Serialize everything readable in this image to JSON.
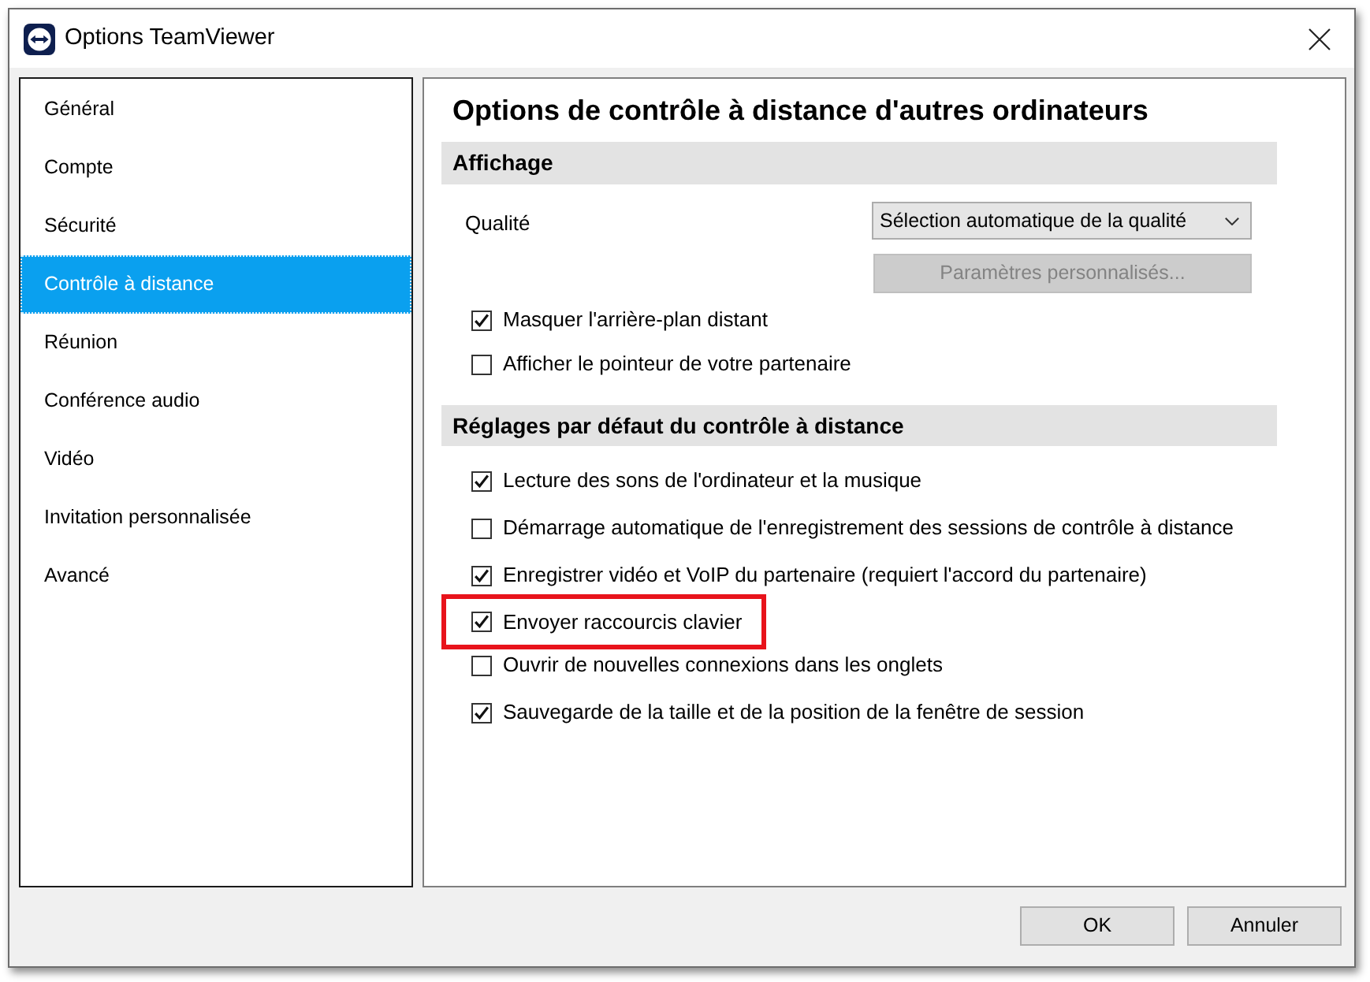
{
  "window": {
    "title": "Options TeamViewer"
  },
  "sidebar": {
    "items": [
      {
        "label": "Général",
        "selected": false
      },
      {
        "label": "Compte",
        "selected": false
      },
      {
        "label": "Sécurité",
        "selected": false
      },
      {
        "label": "Contrôle à distance",
        "selected": true
      },
      {
        "label": "Réunion",
        "selected": false
      },
      {
        "label": "Conférence audio",
        "selected": false
      },
      {
        "label": "Vidéo",
        "selected": false
      },
      {
        "label": "Invitation personnalisée",
        "selected": false
      },
      {
        "label": "Avancé",
        "selected": false
      }
    ]
  },
  "content": {
    "title": "Options de contrôle à distance d'autres ordinateurs",
    "sections": [
      {
        "title": "Affichage",
        "rows": [
          {
            "kind": "dropdown",
            "label": "Qualité",
            "value": "Sélection automatique de la qualité"
          },
          {
            "kind": "button",
            "label": "Paramètres personnalisés...",
            "disabled": true
          },
          {
            "kind": "checkbox",
            "label": "Masquer l'arrière-plan distant",
            "checked": true,
            "highlighted": false
          },
          {
            "kind": "checkbox",
            "label": "Afficher le pointeur de votre partenaire",
            "checked": false,
            "highlighted": false
          }
        ]
      },
      {
        "title": "Réglages par défaut du contrôle à distance",
        "rows": [
          {
            "kind": "checkbox",
            "label": "Lecture des sons de l'ordinateur et la musique",
            "checked": true,
            "highlighted": false
          },
          {
            "kind": "checkbox",
            "label": "Démarrage automatique de l'enregistrement des sessions de contrôle à distance",
            "checked": false,
            "highlighted": false
          },
          {
            "kind": "checkbox",
            "label": "Enregistrer vidéo et VoIP du partenaire (requiert l'accord du partenaire)",
            "checked": true,
            "highlighted": false
          },
          {
            "kind": "checkbox",
            "label": "Envoyer raccourcis clavier",
            "checked": true,
            "highlighted": true
          },
          {
            "kind": "checkbox",
            "label": "Ouvrir de nouvelles connexions dans les onglets",
            "checked": false,
            "highlighted": false
          },
          {
            "kind": "checkbox",
            "label": "Sauvegarde de la taille et de la position de la fenêtre de session",
            "checked": true,
            "highlighted": false
          }
        ]
      }
    ]
  },
  "buttons": [
    {
      "label": "OK"
    },
    {
      "label": "Annuler"
    }
  ]
}
